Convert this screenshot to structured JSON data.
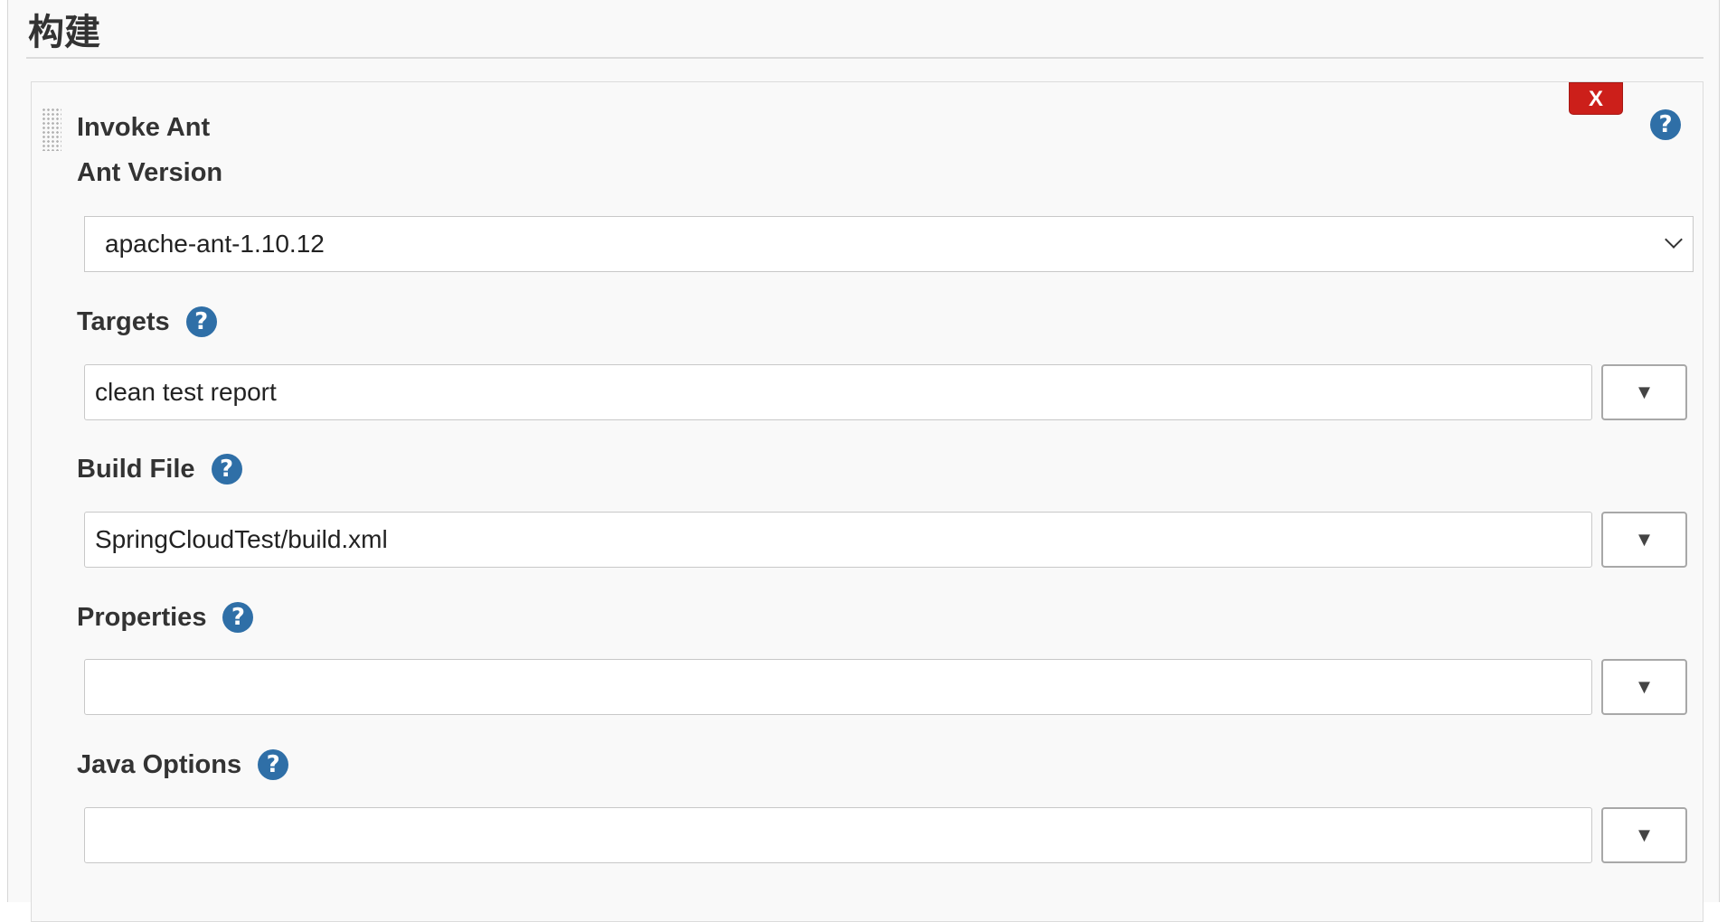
{
  "section": {
    "title": "构建"
  },
  "builder": {
    "title": "Invoke Ant",
    "delete_label": "X",
    "help_glyph": "?"
  },
  "fields": {
    "ant_version": {
      "label": "Ant Version",
      "value": "apache-ant-1.10.12"
    },
    "targets": {
      "label": "Targets",
      "value": "clean test report"
    },
    "build_file": {
      "label": "Build File",
      "value": "SpringCloudTest/build.xml"
    },
    "properties": {
      "label": "Properties",
      "value": ""
    },
    "java_options": {
      "label": "Java Options",
      "value": ""
    }
  },
  "expand_glyph": "▼",
  "icons": {
    "help": "help-icon",
    "drag": "drag-handle-icon",
    "dropdown": "chevron-down-icon"
  },
  "colors": {
    "help_blue": "#2f6fa7",
    "delete_red": "#cc1f1a"
  }
}
